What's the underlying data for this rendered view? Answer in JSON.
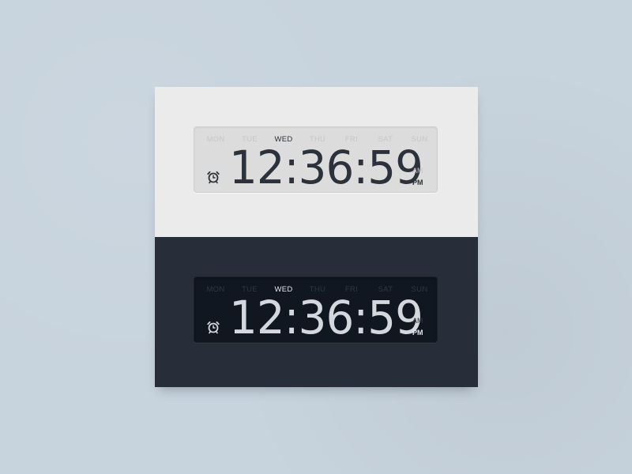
{
  "colors": {
    "background": "#c7d3dd",
    "light_panel": "#ebebeb",
    "dark_panel": "#282e39",
    "light_lcd": "#dcdcdc",
    "dark_lcd": "#111720"
  },
  "clocks": [
    {
      "theme": "light",
      "days": [
        "MON",
        "TUE",
        "WED",
        "THU",
        "FRI",
        "SAT",
        "SUN"
      ],
      "active_day": "WED",
      "time": "12:36:59",
      "am_label": "AM",
      "pm_label": "PM",
      "active_period": "PM",
      "icon": "alarm-clock-icon"
    },
    {
      "theme": "dark",
      "days": [
        "MON",
        "TUE",
        "WED",
        "THU",
        "FRI",
        "SAT",
        "SUN"
      ],
      "active_day": "WED",
      "time": "12:36:59",
      "am_label": "AM",
      "pm_label": "PM",
      "active_period": "PM",
      "icon": "alarm-clock-icon"
    }
  ]
}
